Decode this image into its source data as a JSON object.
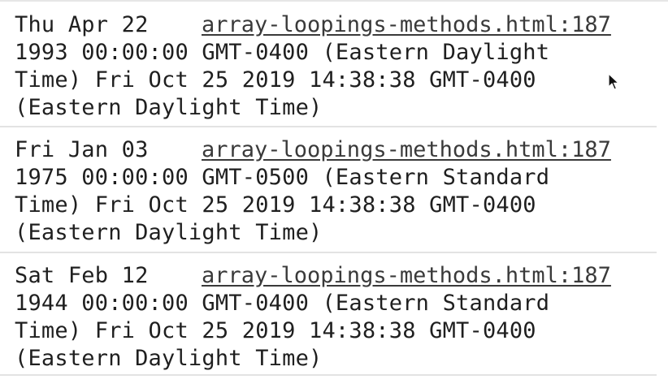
{
  "console": {
    "entries": [
      {
        "lines": [
          "Thu Apr 22",
          "1993 00:00:00 GMT-0400 (Eastern Daylight",
          "Time) Fri Oct 25 2019 14:38:38 GMT-0400",
          "(Eastern Daylight Time)"
        ],
        "source": "array-loopings-methods.html:187"
      },
      {
        "lines": [
          "Fri Jan 03",
          "1975 00:00:00 GMT-0500 (Eastern Standard",
          "Time) Fri Oct 25 2019 14:38:38 GMT-0400",
          "(Eastern Daylight Time)"
        ],
        "source": "array-loopings-methods.html:187"
      },
      {
        "lines": [
          "Sat Feb 12",
          "1944 00:00:00 GMT-0400 (Eastern Standard",
          "Time) Fri Oct 25 2019 14:38:38 GMT-0400",
          "(Eastern Daylight Time)"
        ],
        "source": "array-loopings-methods.html:187"
      }
    ]
  },
  "cursor": {
    "icon": "mouse-pointer-icon"
  }
}
